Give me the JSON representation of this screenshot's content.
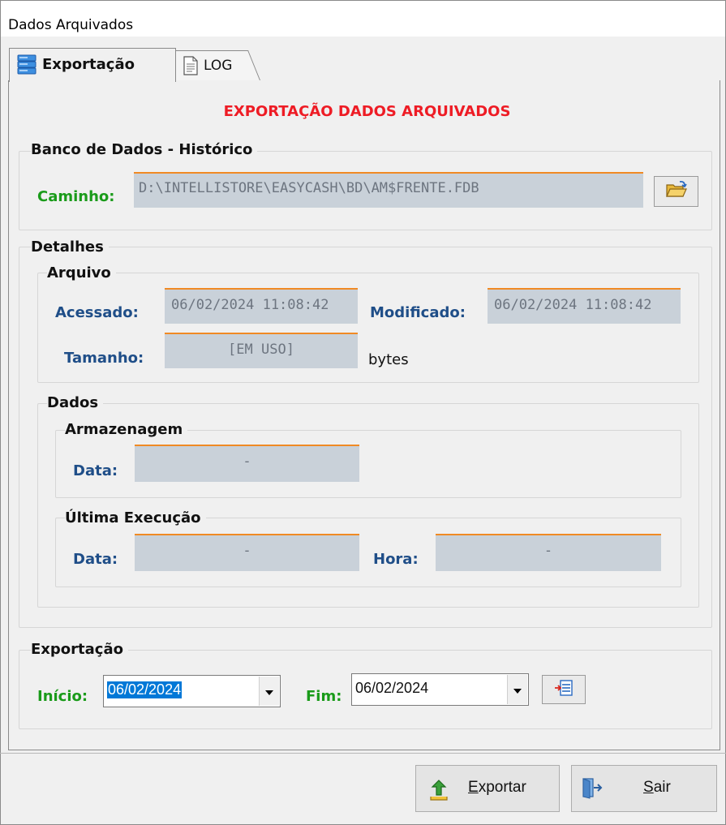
{
  "window": {
    "title": "Dados Arquivados"
  },
  "tabs": [
    {
      "label": "Exportação",
      "icon": "database-icon",
      "active": true
    },
    {
      "label": "LOG",
      "icon": "document-icon",
      "active": false
    }
  ],
  "heading": "EXPORTAÇÃO DADOS ARQUIVADOS",
  "banco": {
    "group_label": "Banco de Dados - Histórico",
    "caminho_label": "Caminho:",
    "caminho_value": "D:\\INTELLISTORE\\EASYCASH\\BD\\AM$FRENTE.FDB",
    "browse_icon": "folder-open-icon"
  },
  "detalhes": {
    "group_label": "Detalhes",
    "arquivo": {
      "group_label": "Arquivo",
      "acessado_label": "Acessado:",
      "acessado_value": "06/02/2024 11:08:42",
      "modificado_label": "Modificado:",
      "modificado_value": "06/02/2024 11:08:42",
      "tamanho_label": "Tamanho:",
      "tamanho_value": "[EM USO]",
      "tamanho_unit": "bytes"
    },
    "dados": {
      "group_label": "Dados",
      "armazenagem": {
        "group_label": "Armazenagem",
        "data_label": "Data:",
        "data_value": "-"
      },
      "ultima": {
        "group_label": "Última Execução",
        "data_label": "Data:",
        "data_value": "-",
        "hora_label": "Hora:",
        "hora_value": "-"
      }
    }
  },
  "exportacao": {
    "group_label": "Exportação",
    "inicio_label": "Início:",
    "inicio_value": "06/02/2024",
    "fim_label": "Fim:",
    "fim_value": "06/02/2024",
    "calendar_icon": "calendar-icon"
  },
  "footer": {
    "exportar_label_first": "E",
    "exportar_label_rest": "xportar",
    "exportar_icon": "export-arrow-icon",
    "sair_label_first": "S",
    "sair_label_rest": "air",
    "sair_icon": "exit-door-icon"
  },
  "colors": {
    "heading": "#ee1c25",
    "label_green": "#1a9b1a",
    "label_blue": "#1f4e88",
    "field_bg": "#c9d1d9",
    "field_accent": "#f08a24",
    "selection": "#0078d7"
  }
}
